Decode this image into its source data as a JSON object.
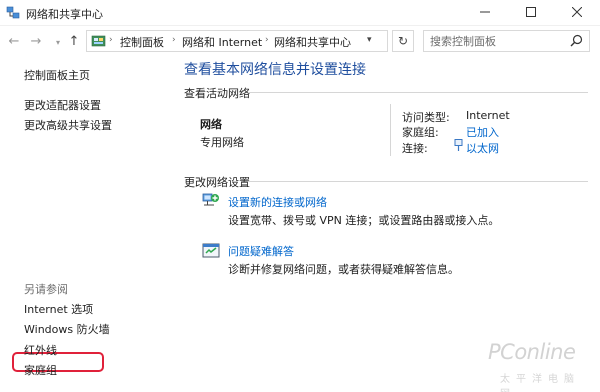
{
  "window": {
    "title": "网络和共享中心",
    "minimize_icon": "minimize-icon",
    "maximize_icon": "maximize-icon",
    "close_icon": "close-icon"
  },
  "address_bar": {
    "breadcrumbs": [
      "控制面板",
      "网络和 Internet",
      "网络和共享中心"
    ],
    "search_placeholder": "搜索控制面板"
  },
  "left_pane": {
    "links": [
      "控制面板主页",
      "更改适配器设置",
      "更改高级共享设置"
    ],
    "see_also_heading": "另请参阅",
    "see_also_links": [
      "Internet 选项",
      "Windows 防火墙",
      "红外线",
      "家庭组"
    ],
    "highlighted_item": "Internet 选项",
    "highlight_color": "#e0213a"
  },
  "main": {
    "title": "查看基本网络信息并设置连接",
    "active_networks_heading": "查看活动网络",
    "network": {
      "name": "网络",
      "type": "专用网络",
      "properties": [
        {
          "label": "访问类型:",
          "value": "Internet",
          "is_link": false
        },
        {
          "label": "家庭组:",
          "value": "已加入",
          "is_link": true
        },
        {
          "label": "连接:",
          "value": "以太网",
          "is_link": true,
          "icon": "ethernet-icon"
        }
      ]
    },
    "change_settings_heading": "更改网络设置",
    "tasks": [
      {
        "icon": "network-setup-icon",
        "link": "设置新的连接或网络",
        "description": "设置宽带、拨号或 VPN 连接；或设置路由器或接入点。"
      },
      {
        "icon": "troubleshoot-icon",
        "link": "问题疑难解答",
        "description": "诊断并修复网络问题，或者获得疑难解答信息。"
      }
    ]
  },
  "watermark": {
    "brand": "PConline",
    "tagline": "太平洋电脑网"
  },
  "colors": {
    "link": "#0066cc",
    "title_blue": "#1f4e9e"
  }
}
